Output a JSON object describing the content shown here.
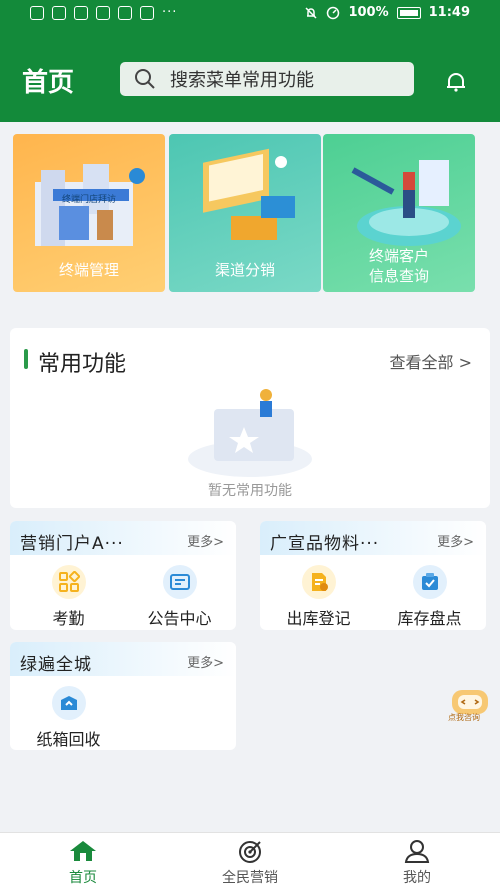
{
  "status_bar": {
    "battery": "100%",
    "time": "11:49"
  },
  "header": {
    "title": "首页",
    "search_placeholder": "搜索菜单常用功能"
  },
  "banners": [
    {
      "label": "终端管理",
      "sign": "终端门店拜访"
    },
    {
      "label": "渠道分销"
    },
    {
      "label_line1": "终端客户",
      "label_line2": "信息查询"
    }
  ],
  "common": {
    "title": "常用功能",
    "view_all": "查看全部 >",
    "empty": "暂无常用功能"
  },
  "modules": [
    {
      "title": "营销门户A···",
      "more": "更多>",
      "items": [
        {
          "label": "考勤",
          "icon": "attendance-icon"
        },
        {
          "label": "公告中心",
          "icon": "notice-icon"
        }
      ]
    },
    {
      "title": "广宣品物料···",
      "more": "更多>",
      "items": [
        {
          "label": "出库登记",
          "icon": "outbound-icon"
        },
        {
          "label": "库存盘点",
          "icon": "inventory-icon"
        }
      ]
    },
    {
      "title": "绿遍全城",
      "more": "更多>",
      "items": [
        {
          "label": "纸箱回收",
          "icon": "box-recycle-icon"
        }
      ]
    }
  ],
  "assistant": {
    "label": "点我咨询"
  },
  "tabs": [
    {
      "label": "首页",
      "icon": "home-icon",
      "active": true
    },
    {
      "label": "全民营销",
      "icon": "target-icon",
      "active": false
    },
    {
      "label": "我的",
      "icon": "person-icon",
      "active": false
    }
  ],
  "colors": {
    "primary": "#138a3a",
    "tab_active": "#1a8a3c",
    "attendance": "#f5b21e",
    "notice": "#2b8ad6"
  }
}
